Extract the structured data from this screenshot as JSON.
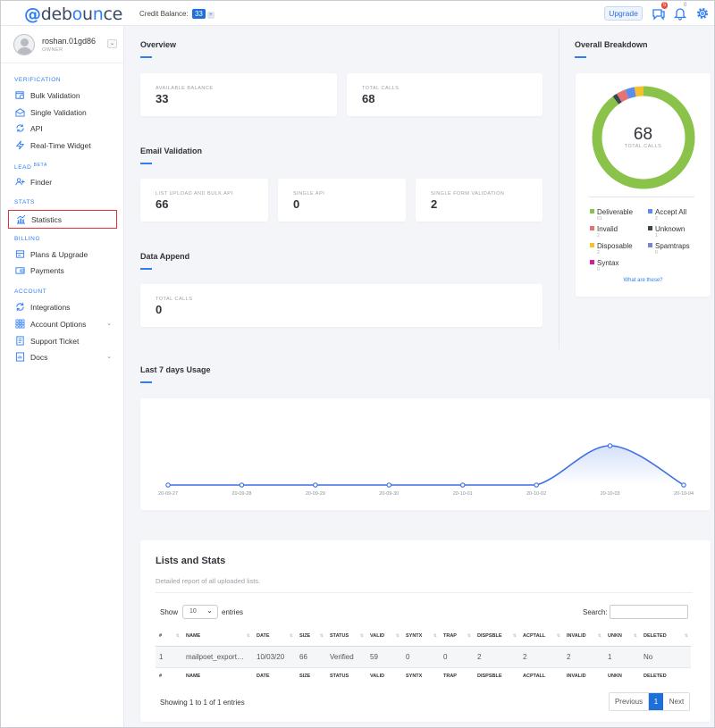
{
  "topbar": {
    "logo": "@debounce",
    "credit_label": "Credit Balance:",
    "credit_value": "33",
    "upgrade_label": "Upgrade",
    "notif_count": "5",
    "bell_count": "0"
  },
  "user": {
    "name": "roshan.01gd86",
    "role": "OWNER"
  },
  "sidebar": {
    "verification_title": "VERIFICATION",
    "lead_title": "LEAD",
    "lead_badge": "BETA",
    "stats_title": "STATS",
    "billing_title": "BILLING",
    "account_title": "ACCOUNT",
    "items": [
      {
        "label": "Bulk Validation",
        "icon": "bulk-validation-icon"
      },
      {
        "label": "Single Validation",
        "icon": "envelope-check-icon"
      },
      {
        "label": "API",
        "icon": "api-icon"
      },
      {
        "label": "Real-Time Widget",
        "icon": "bolt-icon"
      },
      {
        "label": "Finder",
        "icon": "user-plus-icon"
      },
      {
        "label": "Statistics",
        "icon": "chart-icon"
      },
      {
        "label": "Plans & Upgrade",
        "icon": "plans-icon"
      },
      {
        "label": "Payments",
        "icon": "wallet-icon"
      },
      {
        "label": "Integrations",
        "icon": "sync-icon"
      },
      {
        "label": "Account Options",
        "icon": "grid-icon"
      },
      {
        "label": "Support Ticket",
        "icon": "ticket-icon"
      },
      {
        "label": "Docs",
        "icon": "docs-icon"
      }
    ]
  },
  "overview": {
    "title": "Overview",
    "available_balance_label": "AVAILABLE BALANCE",
    "available_balance": "33",
    "total_calls_label": "TOTAL CALLS",
    "total_calls": "68"
  },
  "email_validation": {
    "title": "Email Validation",
    "list_label": "LIST UPLOAD AND BULK API",
    "list_value": "66",
    "single_api_label": "SINGLE API",
    "single_api_value": "0",
    "single_form_label": "SINGLE FORM VALIDATION",
    "single_form_value": "2"
  },
  "data_append": {
    "title": "Data Append",
    "total_calls_label": "TOTAL CALLS",
    "total_calls": "0"
  },
  "breakdown": {
    "title": "Overall Breakdown",
    "total": "68",
    "total_label": "TOTAL CALLS",
    "legend": [
      {
        "label": "Deliverable",
        "value": "61",
        "color": "#8bc34a"
      },
      {
        "label": "Accept All",
        "value": "2",
        "color": "#5b8def"
      },
      {
        "label": "Invalid",
        "value": "2",
        "color": "#e57373"
      },
      {
        "label": "Unknown",
        "value": "1",
        "color": "#37474f"
      },
      {
        "label": "Disposable",
        "value": "2",
        "color": "#f5c02c"
      },
      {
        "label": "Spamtraps",
        "value": "0",
        "color": "#7986cb"
      },
      {
        "label": "Syntax",
        "value": "0",
        "color": "#d81b9c"
      }
    ],
    "help_link": "What are these?"
  },
  "usage": {
    "title": "Last 7 days Usage"
  },
  "chart_data": {
    "type": "area",
    "categories": [
      "20-09-27",
      "20-09-28",
      "20-09-29",
      "20-09-30",
      "20-10-01",
      "20-10-02",
      "20-10-03",
      "20-10-04"
    ],
    "values": [
      0,
      0,
      0,
      0,
      0,
      0,
      66,
      0
    ],
    "color": "#3d6fe3"
  },
  "lists": {
    "title": "Lists and Stats",
    "subtitle": "Detailed report of all uploaded lists.",
    "show_label": "Show",
    "entries_value": "10",
    "entries_label": "entries",
    "search_label": "Search:",
    "columns": [
      "#",
      "NAME",
      "DATE",
      "SIZE",
      "STATUS",
      "VALID",
      "SYNTX",
      "TRAP",
      "DISPSBLE",
      "ACPTALL",
      "INVALID",
      "UNKN",
      "DELETED"
    ],
    "rows": [
      [
        "1",
        "mailpoet_export…",
        "10/03/20",
        "66",
        "Verified",
        "59",
        "0",
        "0",
        "2",
        "2",
        "2",
        "1",
        "No"
      ]
    ],
    "info": "Showing 1 to 1 of 1 entries",
    "prev_label": "Previous",
    "page": "1",
    "next_label": "Next"
  }
}
